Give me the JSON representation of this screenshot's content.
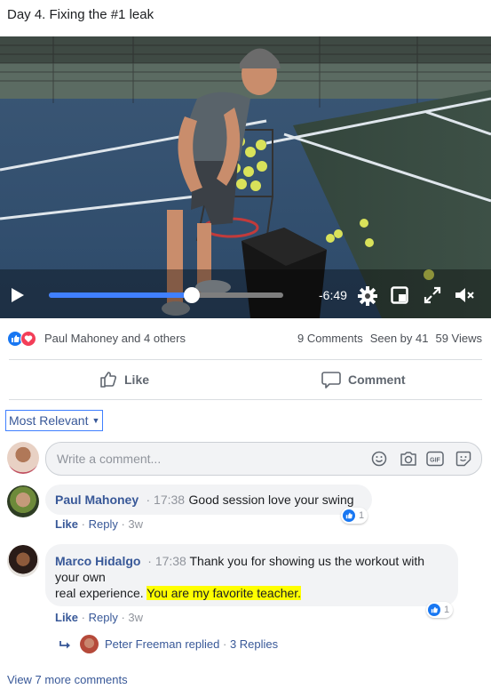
{
  "post": {
    "title": "Day 4. Fixing the #1 leak"
  },
  "video": {
    "time_remaining": "-6:49",
    "progress": 0.61,
    "icons": [
      "play-icon",
      "gear-icon",
      "miniplayer-icon",
      "fullscreen-icon",
      "mute-icon"
    ]
  },
  "reactions": {
    "names": "Paul Mahoney and 4 others",
    "comments": "9 Comments",
    "seen": "Seen by 41",
    "views": "59 Views",
    "icons": [
      "like-icon",
      "love-icon"
    ]
  },
  "actions": {
    "like": "Like",
    "comment": "Comment"
  },
  "sort": {
    "label": "Most Relevant"
  },
  "composer": {
    "placeholder": "Write a comment...",
    "icons": [
      "emoji-icon",
      "camera-icon",
      "gif-icon",
      "sticker-icon"
    ]
  },
  "comments": [
    {
      "author": "Paul Mahoney",
      "time": "17:38",
      "text": "Good session love your swing",
      "like": "Like",
      "reply": "Reply",
      "age": "3w",
      "reaction_count": "1"
    },
    {
      "author": "Marco Hidalgo",
      "time": "17:38",
      "text_line1": "Thank you for showing us the workout with",
      "text_line2": "your own",
      "text_line3": "real experience.",
      "text_highlight": "You are my favorite teacher.",
      "like": "Like",
      "reply": "Reply",
      "age": "3w",
      "reaction_count": "1",
      "replies": {
        "name": "Peter Freeman",
        "action": "replied",
        "count": "3 Replies"
      }
    }
  ],
  "view_more": "View 7 more comments",
  "colors": {
    "link": "#385898",
    "accent": "#4080ff",
    "highlight": "#ffff00",
    "like_blue": "#1877f2",
    "love_red": "#f33e58"
  }
}
